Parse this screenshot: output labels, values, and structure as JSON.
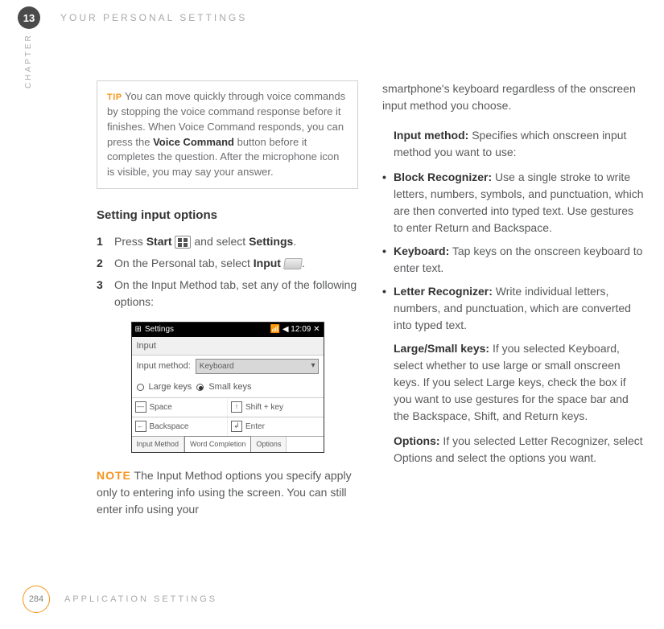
{
  "chapter": {
    "number": "13",
    "label": "CHAPTER",
    "title": "YOUR PERSONAL SETTINGS"
  },
  "tip": {
    "label": "TIP",
    "text_before": " You can move quickly through voice commands by stopping the voice command response before it finishes. When Voice Command responds, you can press the ",
    "bold": "Voice Command",
    "text_after": " button before it completes the question. After the microphone icon is visible, you may say your answer."
  },
  "section_heading": "Setting input options",
  "steps": {
    "s1": {
      "num": "1",
      "a": "Press ",
      "b": "Start",
      "c": " and select ",
      "d": "Settings",
      "e": "."
    },
    "s2": {
      "num": "2",
      "a": "On the Personal tab, select ",
      "b": "Input",
      "c": "."
    },
    "s3": {
      "num": "3",
      "a": "On the Input Method tab, set any of the following options:"
    }
  },
  "screenshot": {
    "topbar_left": "Settings",
    "topbar_right": "12:09",
    "tab": "Input",
    "row_label": "Input method:",
    "field_value": "Keyboard",
    "radio_large": "Large keys",
    "radio_small": "Small keys",
    "space": "Space",
    "shift": "Shift + key",
    "backspace": "Backspace",
    "enter": "Enter",
    "btab1": "Input Method",
    "btab2": "Word Completion",
    "btab3": "Options"
  },
  "note": {
    "label": "NOTE",
    "text": " The Input Method options you specify apply only to entering info using the screen. You can still enter info using your"
  },
  "col2": {
    "cont": "smartphone's keyboard regardless of the onscreen input method you choose.",
    "input_method": {
      "h": "Input method:",
      "t": " Specifies which onscreen input method you want to use:"
    },
    "block": {
      "h": "Block Recognizer:",
      "t": " Use a single stroke to write letters, numbers, symbols, and punctuation, which are then converted into typed text. Use gestures to enter Return and Backspace."
    },
    "keyboard": {
      "h": "Keyboard:",
      "t": " Tap keys on the onscreen keyboard to enter text."
    },
    "letter": {
      "h": "Letter Recognizer:",
      "t": " Write individual letters, numbers, and punctuation, which are converted into typed text."
    },
    "large": {
      "h": "Large/Small keys:",
      "t": " If you selected Keyboard, select whether to use large or small onscreen keys. If you select Large keys, check the box if you want to use gestures for the space bar and the Backspace, Shift, and Return keys."
    },
    "options": {
      "h": "Options:",
      "t": " If you selected Letter Recognizer, select Options and select the options you want."
    }
  },
  "footer": {
    "page": "284",
    "title": "APPLICATION SETTINGS"
  }
}
